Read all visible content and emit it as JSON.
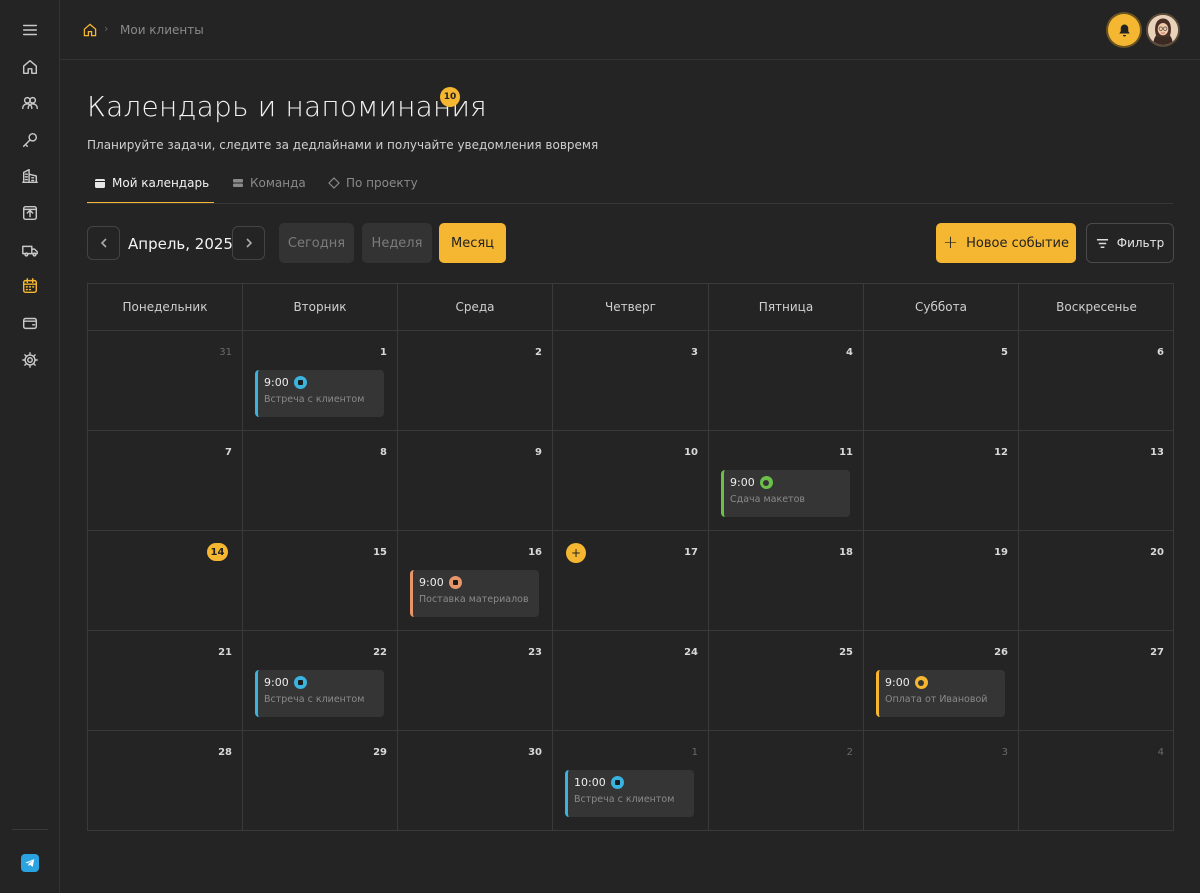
{
  "breadcrumb": {
    "current": "Мои клиенты"
  },
  "header": {
    "title": "Календарь и напоминания",
    "badge": "10",
    "subtitle": "Планируйте задачи, следите за дедлайнами и получайте уведомления вовремя"
  },
  "tabs": [
    {
      "label": "Мой календарь",
      "active": true
    },
    {
      "label": "Команда",
      "active": false
    },
    {
      "label": "По проекту",
      "active": false
    }
  ],
  "toolbar": {
    "month": "Апрель, 2025",
    "today": "Сегодня",
    "week": "Неделя",
    "month_view": "Месяц",
    "new_event": "Новое событие",
    "filter": "Фильтр"
  },
  "weekdays": [
    "Понедельник",
    "Вторник",
    "Среда",
    "Четверг",
    "Пятница",
    "Суббота",
    "Воскресенье"
  ],
  "weeks": [
    [
      "31",
      "1",
      "2",
      "3",
      "4",
      "5",
      "6"
    ],
    [
      "7",
      "8",
      "9",
      "10",
      "11",
      "12",
      "13"
    ],
    [
      "14",
      "15",
      "16",
      "17",
      "18",
      "19",
      "20"
    ],
    [
      "21",
      "22",
      "23",
      "24",
      "25",
      "26",
      "27"
    ],
    [
      "28",
      "29",
      "30",
      "1",
      "2",
      "3",
      "4"
    ]
  ],
  "events": {
    "w0d1": {
      "time": "9:00",
      "title": "Встреча с клиентом"
    },
    "w1d4": {
      "time": "9:00",
      "title": "Сдача макетов"
    },
    "w2d2": {
      "time": "9:00",
      "title": "Поставка материалов"
    },
    "w3d1": {
      "time": "9:00",
      "title": "Встреча с клиентом"
    },
    "w3d5": {
      "time": "9:00",
      "title": "Оплата от Ивановой"
    },
    "w4d3": {
      "time": "10:00",
      "title": "Встреча с клиентом"
    }
  },
  "add_symbol": "+",
  "colors": {
    "accent": "#f5b731",
    "meeting": "#3ab3e0",
    "deadline": "#6cc04a",
    "delivery": "#e8956a",
    "payment": "#f5b731"
  }
}
